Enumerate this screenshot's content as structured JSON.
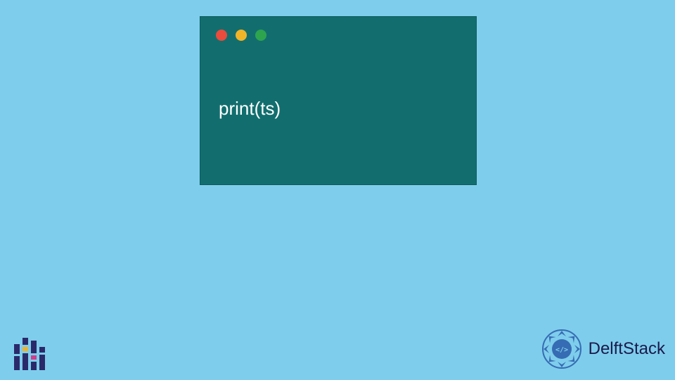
{
  "window": {
    "traffic_lights": {
      "close": "close",
      "minimize": "minimize",
      "maximize": "maximize"
    },
    "code": "print(ts)"
  },
  "branding": {
    "name": "DelftStack"
  },
  "colors": {
    "background": "#7ecdec",
    "window_bg": "#126e6e",
    "dot_red": "#e94b3c",
    "dot_yellow": "#f0b429",
    "dot_green": "#2ea44f",
    "brand_blue": "#2a5caa"
  }
}
